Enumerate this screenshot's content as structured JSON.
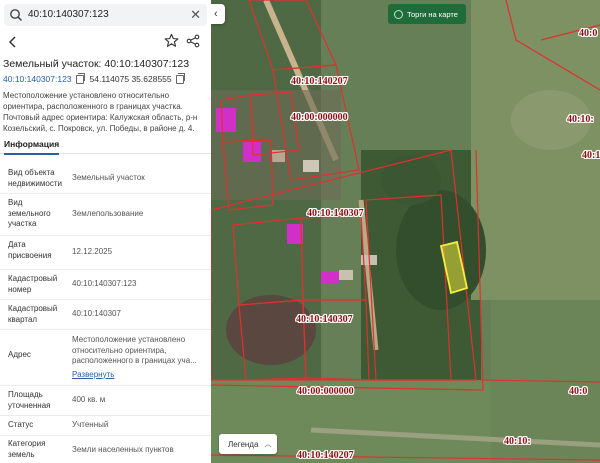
{
  "search": {
    "query": "40:10:140307:123"
  },
  "card": {
    "title": "Земельный участок: 40:10:140307:123",
    "cadastral_link": "40:10:140307:123",
    "coordinates": "54.114075 35.628555",
    "description": "Местоположение установлено относительно ориентира, расположенного в границах участка. Почтовый адрес ориентира: Калужская область, р-н Козельский, с. Покровск, ул. Победы, в районе д. 4.",
    "tab_info": "Информация"
  },
  "rows": [
    {
      "label": "Вид объекта недвижимости",
      "value": "Земельный участок"
    },
    {
      "label": "Вид земельного участка",
      "value": "Землепользование"
    },
    {
      "label": "Дата присвоения",
      "value": "12.12.2025"
    },
    {
      "label": "Кадастровый номер",
      "value": "40:10:140307:123"
    },
    {
      "label": "Кадастровый квартал",
      "value": "40:10:140307"
    },
    {
      "label": "Адрес",
      "value": "Местоположение установлено относительно ориентира, расположенного в границах уча...",
      "more": "Развернуть"
    },
    {
      "label": "Площадь уточненная",
      "value": "400 кв. м"
    },
    {
      "label": "Статус",
      "value": "Учтенный"
    },
    {
      "label": "Категория земель",
      "value": "Земли населенных пунктов"
    }
  ],
  "map": {
    "torgi_button": "Торги на карте",
    "legend_button": "Легенда",
    "labels": [
      "40:10:140207",
      "40:00:000000",
      "40:10:140307",
      "40:10:140307",
      "40:00:000000",
      "40:10:140207",
      "40:10:",
      "40:0",
      "40:10:",
      "40:0",
      "40:10:"
    ]
  },
  "colors": {
    "accent": "#2860a8",
    "parcel_border": "#e03030",
    "selected_parcel": "#e8e23a",
    "torgi_bg": "#1f6b3a"
  }
}
